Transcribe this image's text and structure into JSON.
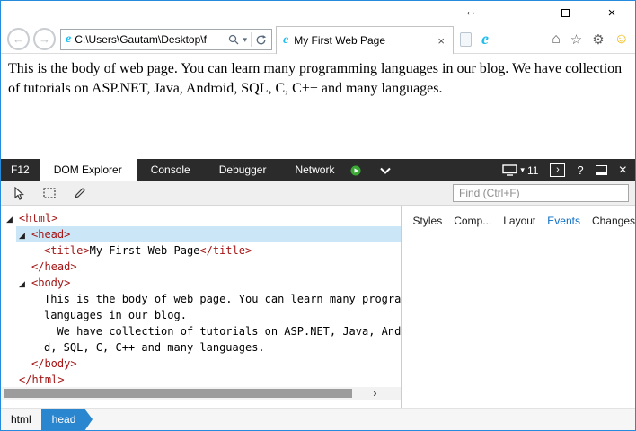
{
  "icons": {
    "resize": "↔",
    "close": "×",
    "back": "←",
    "forward": "→",
    "chevron_down": "▾",
    "home": "⌂",
    "star": "☆",
    "gear": "⚙",
    "smiley": "☺",
    "expander": "◢",
    "scroll_right": "›",
    "ie_logo": "e",
    "console_prompt": "›"
  },
  "browser": {
    "address": "C:\\Users\\Gautam\\Desktop\\f",
    "tab_title": "My First Web Page",
    "page_text": "This is the body of web page. You can learn many programming languages in our blog. We have collection of tutorials on ASP.NET, Java, Android, SQL, C, C++ and many languages."
  },
  "devtools": {
    "f12_label": "F12",
    "tabs": [
      {
        "label": "DOM Explorer"
      },
      {
        "label": "Console"
      },
      {
        "label": "Debugger"
      },
      {
        "label": "Network"
      }
    ],
    "active_tab": "DOM Explorer",
    "doc_mode": "11",
    "help_icon": "?",
    "find_placeholder": "Find (Ctrl+F)",
    "dom_tree": [
      {
        "text": "<html>"
      },
      {
        "text": "<head>"
      },
      {
        "open": "<title>",
        "text": "My First Web Page",
        "close": "</title>"
      },
      {
        "text": "</head>"
      },
      {
        "text": "<body>"
      },
      {
        "text": "This is the body of web page. You can learn many programming"
      },
      {
        "text": "languages in our blog."
      },
      {
        "text": "  We have collection of tutorials on ASP.NET, Java, Androi"
      },
      {
        "text": "d, SQL, C, C++ and many languages."
      },
      {
        "text": "</body>"
      },
      {
        "text": "</html>"
      }
    ],
    "right_tabs": [
      "Styles",
      "Comp...",
      "Layout",
      "Events",
      "Changes"
    ],
    "right_active_tab": "Events",
    "breadcrumbs": [
      "html",
      "head"
    ]
  }
}
